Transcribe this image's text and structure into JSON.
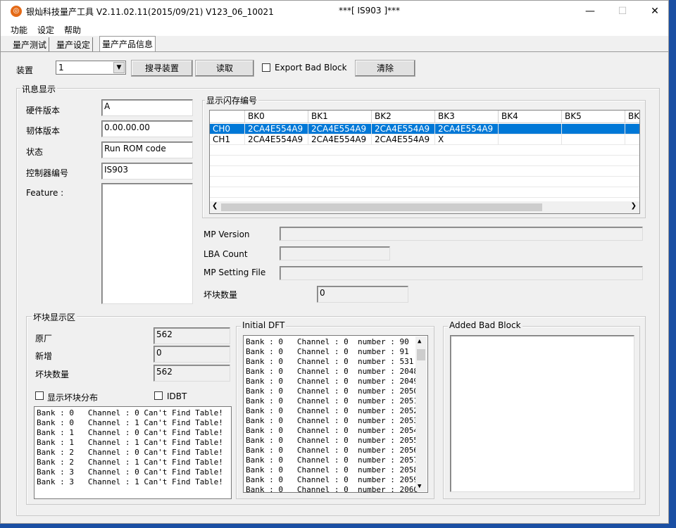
{
  "titlebar": {
    "app_icon": "app-logo-icon",
    "title": "银灿科技量产工具 V2.11.02.11(2015/09/21)    V123_06_10021",
    "center_title": "***[ IS903 ]***",
    "minimize": "—",
    "maximize": "☐",
    "close": "✕"
  },
  "menu": [
    "功能",
    "设定",
    "帮助"
  ],
  "tabs": [
    "量产测试",
    "量产设定",
    "量产产品信息"
  ],
  "toolbar": {
    "device_label": "装置",
    "device_value": "1",
    "search_btn": "搜寻装置",
    "read_btn": "读取",
    "export_label": "Export Bad Block",
    "clear_btn": "清除"
  },
  "info": {
    "title": "讯息显示",
    "hw_label": "硬件版本",
    "hw_value": "A",
    "fw_label": "韧体版本",
    "fw_value": "0.00.00.00",
    "status_label": "状态",
    "status_value": "Run ROM code",
    "ctrl_label": "控制器编号",
    "ctrl_value": "IS903",
    "feature_label": "Feature :"
  },
  "flash": {
    "title": "显示闪存编号",
    "columns": [
      "",
      "BK0",
      "BK1",
      "BK2",
      "BK3",
      "BK4",
      "BK5",
      "BK"
    ],
    "rows": [
      [
        "CH0",
        "2CA4E554A9",
        "2CA4E554A9",
        "2CA4E554A9",
        "2CA4E554A9",
        "",
        "",
        ""
      ],
      [
        "CH1",
        "2CA4E554A9",
        "2CA4E554A9",
        "2CA4E554A9",
        "X",
        "",
        "",
        ""
      ]
    ]
  },
  "mp": {
    "version_label": "MP Version",
    "version_value": "",
    "lba_label": "LBA Count",
    "lba_value": "",
    "setting_label": "MP Setting File",
    "setting_value": "",
    "bad_label": "坏块数量",
    "bad_value": "0"
  },
  "badblock": {
    "title": "坏块显示区",
    "orig_label": "原厂",
    "orig_value": "562",
    "new_label": "新增",
    "new_value": "0",
    "count_label": "坏块数量",
    "count_value": "562",
    "show_dist_label": "显示坏块分布",
    "idbt_label": "IDBT",
    "list": [
      "Bank : 0   Channel : 0 Can't Find Table!",
      "Bank : 0   Channel : 1 Can't Find Table!",
      "Bank : 1   Channel : 0 Can't Find Table!",
      "Bank : 1   Channel : 1 Can't Find Table!",
      "Bank : 2   Channel : 0 Can't Find Table!",
      "Bank : 2   Channel : 1 Can't Find Table!",
      "Bank : 3   Channel : 0 Can't Find Table!",
      "Bank : 3   Channel : 1 Can't Find Table!"
    ]
  },
  "dft": {
    "title": "Initial DFT",
    "list": [
      "Bank : 0   Channel : 0  number : 90",
      "Bank : 0   Channel : 0  number : 91",
      "Bank : 0   Channel : 0  number : 531",
      "Bank : 0   Channel : 0  number : 2048",
      "Bank : 0   Channel : 0  number : 2049",
      "Bank : 0   Channel : 0  number : 2050",
      "Bank : 0   Channel : 0  number : 2051",
      "Bank : 0   Channel : 0  number : 2052",
      "Bank : 0   Channel : 0  number : 2053",
      "Bank : 0   Channel : 0  number : 2054",
      "Bank : 0   Channel : 0  number : 2055",
      "Bank : 0   Channel : 0  number : 2056",
      "Bank : 0   Channel : 0  number : 2057",
      "Bank : 0   Channel : 0  number : 2058",
      "Bank : 0   Channel : 0  number : 2059",
      "Bank : 0   Channel : 0  number : 2060"
    ]
  },
  "added": {
    "title": "Added Bad Block"
  }
}
